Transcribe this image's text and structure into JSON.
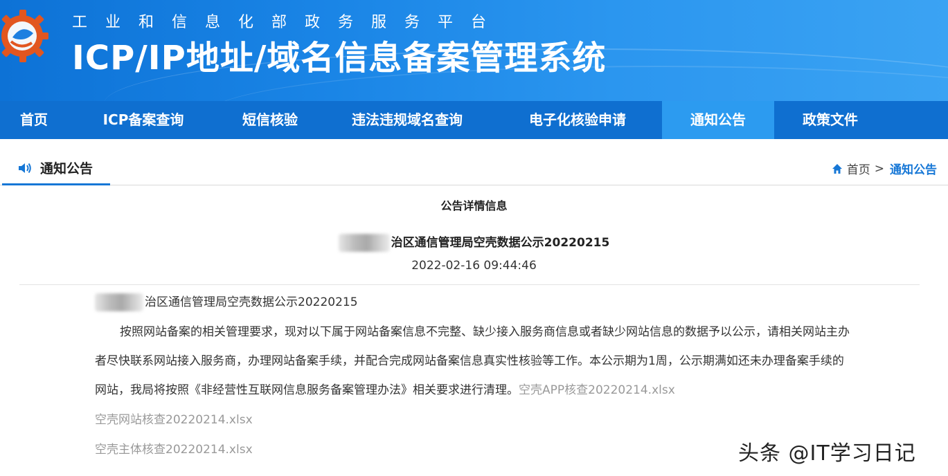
{
  "header": {
    "subtitle": "工业和信息化部政务服务平台",
    "title": "ICP/IP地址/域名信息备案管理系统"
  },
  "nav": {
    "items": [
      {
        "label": "首页"
      },
      {
        "label": "ICP备案查询"
      },
      {
        "label": "短信核验"
      },
      {
        "label": "违法违规域名查询"
      },
      {
        "label": "电子化核验申请"
      },
      {
        "label": "通知公告"
      },
      {
        "label": "政策文件"
      }
    ],
    "active": "通知公告"
  },
  "section": {
    "title": "通知公告",
    "icon": "speaker-icon"
  },
  "breadcrumb": {
    "home": "首页",
    "separator": ">",
    "current": "通知公告",
    "icon": "home-icon"
  },
  "notice": {
    "heading": "公告详情信息",
    "title": "治区通信管理局空壳数据公示20220215",
    "date": "2022-02-16 09:44:46",
    "body_title": "治区通信管理局空壳数据公示20220215",
    "body": "按照网站备案的相关管理要求，现对以下属于网站备案信息不完整、缺少接入服务商信息或者缺少网站信息的数据予以公示，请相关网站主办者尽快联系网站接入服务商，办理网站备案手续，并配合完成网站备案信息真实性核验等工作。本公示期为1周，公示期满如还未办理备案手续的网站，我局将按照《非经营性互联网信息服务备案管理办法》相关要求进行清理。",
    "attachments": [
      "空壳APP核查20220214.xlsx",
      "空壳网站核查20220214.xlsx",
      "空壳主体核查20220214.xlsx"
    ]
  },
  "watermark": "头条 @IT学习日记",
  "colors": {
    "nav_bg": "#0f6fd0",
    "nav_active": "#2c9bf0",
    "accent": "#1677d6",
    "attachment": "#999999"
  }
}
